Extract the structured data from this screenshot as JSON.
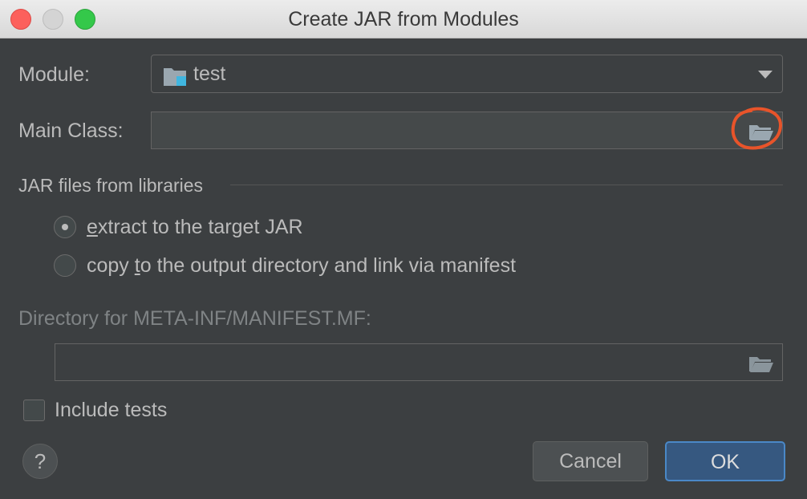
{
  "window": {
    "title": "Create JAR from Modules"
  },
  "module": {
    "label": "Module:",
    "value": "test"
  },
  "main_class": {
    "label": "Main Class:",
    "value": ""
  },
  "libraries": {
    "section_title": "JAR files from libraries",
    "options": [
      {
        "prefix": "",
        "mnemonic": "e",
        "suffix": "xtract to the target JAR",
        "selected": true
      },
      {
        "prefix": "copy ",
        "mnemonic": "t",
        "suffix": "o the output directory and link via manifest",
        "selected": false
      }
    ]
  },
  "manifest": {
    "label": "Directory for META-INF/MANIFEST.MF:",
    "value": ""
  },
  "include_tests": {
    "label": "Include tests",
    "checked": false
  },
  "buttons": {
    "help": "?",
    "cancel": "Cancel",
    "ok": "OK"
  },
  "colors": {
    "background": "#3c3f41",
    "text": "#bbbbbb",
    "ok_button": "#365880",
    "annotation": "#e8542a"
  }
}
